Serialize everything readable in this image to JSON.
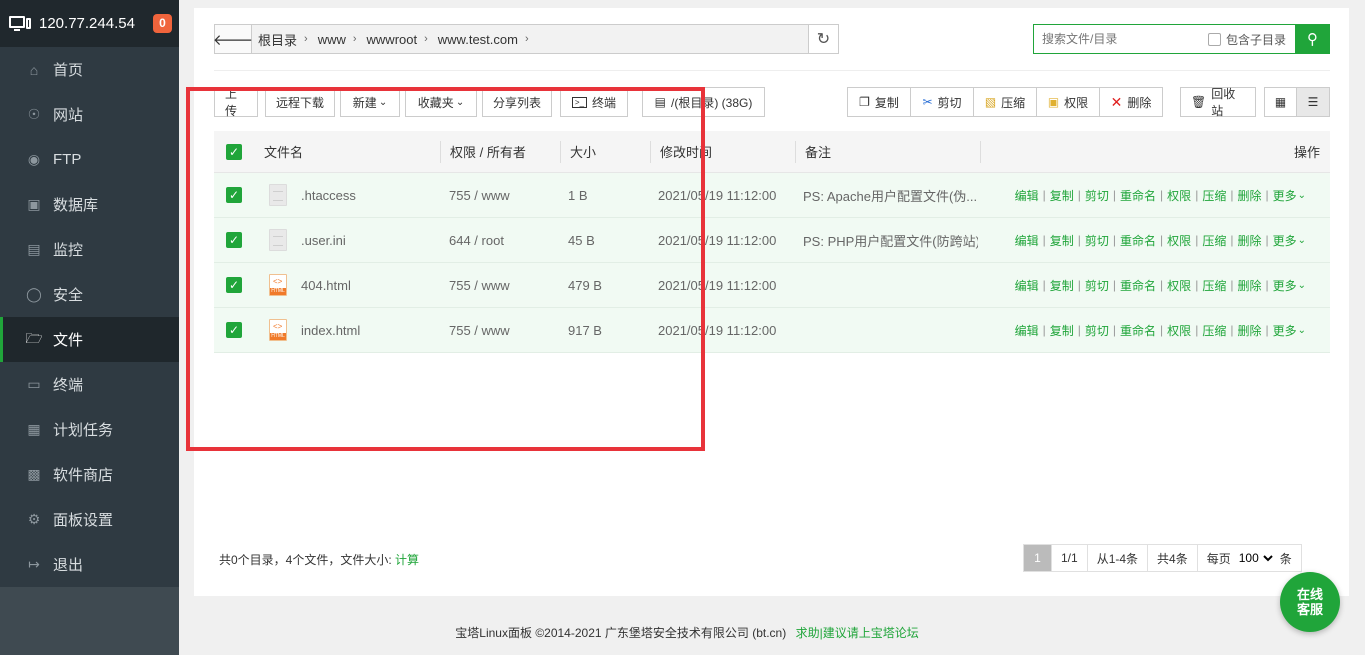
{
  "header": {
    "ip": "120.77.244.54",
    "badge": "0"
  },
  "sidebar": {
    "items": [
      {
        "label": "首页",
        "icon": "home-icon"
      },
      {
        "label": "网站",
        "icon": "globe-icon"
      },
      {
        "label": "FTP",
        "icon": "ftp-icon"
      },
      {
        "label": "数据库",
        "icon": "database-icon"
      },
      {
        "label": "监控",
        "icon": "monitor-chart-icon"
      },
      {
        "label": "安全",
        "icon": "shield-icon"
      },
      {
        "label": "文件",
        "icon": "folder-icon",
        "active": true
      },
      {
        "label": "终端",
        "icon": "terminal-icon"
      },
      {
        "label": "计划任务",
        "icon": "calendar-icon"
      },
      {
        "label": "软件商店",
        "icon": "grid-icon"
      },
      {
        "label": "面板设置",
        "icon": "gear-icon"
      },
      {
        "label": "退出",
        "icon": "logout-icon"
      }
    ]
  },
  "path": {
    "crumbs": [
      "根目录",
      "www",
      "wwwroot",
      "www.test.com"
    ]
  },
  "search": {
    "placeholder": "搜索文件/目录",
    "subdir_label": "包含子目录"
  },
  "toolbar": {
    "upload": "上传",
    "remote_download": "远程下载",
    "new": "新建",
    "favorites": "收藏夹",
    "share_list": "分享列表",
    "terminal": "终端",
    "disk": "/(根目录) (38G)",
    "copy": "复制",
    "cut": "剪切",
    "compress": "压缩",
    "permission": "权限",
    "delete": "删除",
    "recycle": "回收站"
  },
  "table": {
    "headers": {
      "name": "文件名",
      "perm": "权限 / 所有者",
      "size": "大小",
      "mtime": "修改时间",
      "note": "备注",
      "ops": "操作"
    },
    "rows": [
      {
        "name": ".htaccess",
        "type": "doc",
        "perm": "755 / www",
        "size": "1 B",
        "mtime": "2021/05/19 11:12:00",
        "note": "PS: Apache用户配置文件(伪..."
      },
      {
        "name": ".user.ini",
        "type": "doc",
        "perm": "644 / root",
        "size": "45 B",
        "mtime": "2021/05/19 11:12:00",
        "note": "PS: PHP用户配置文件(防跨站)!"
      },
      {
        "name": "404.html",
        "type": "html",
        "perm": "755 / www",
        "size": "479 B",
        "mtime": "2021/05/19 11:12:00",
        "note": ""
      },
      {
        "name": "index.html",
        "type": "html",
        "perm": "755 / www",
        "size": "917 B",
        "mtime": "2021/05/19 11:12:00",
        "note": ""
      }
    ],
    "row_ops": [
      "编辑",
      "复制",
      "剪切",
      "重命名",
      "权限",
      "压缩",
      "删除",
      "更多"
    ]
  },
  "summary": {
    "text": "共0个目录，4个文件，文件大小:",
    "calc": "计算"
  },
  "pager": {
    "current": "1",
    "pages": "1/1",
    "range": "从1-4条",
    "total": "共4条",
    "per_page_label": "每页",
    "per_page": "100",
    "unit": "条"
  },
  "footer": {
    "copyright": "宝塔Linux面板 ©2014-2021 广东堡塔安全技术有限公司 (bt.cn)",
    "help": "求助|建议请上宝塔论坛"
  },
  "chat": {
    "line1": "在线",
    "line2": "客服"
  },
  "colors": {
    "accent": "#20a53a",
    "sidebar": "#2f3a42",
    "highlight": "#e8333a",
    "badge": "#f0643c"
  }
}
